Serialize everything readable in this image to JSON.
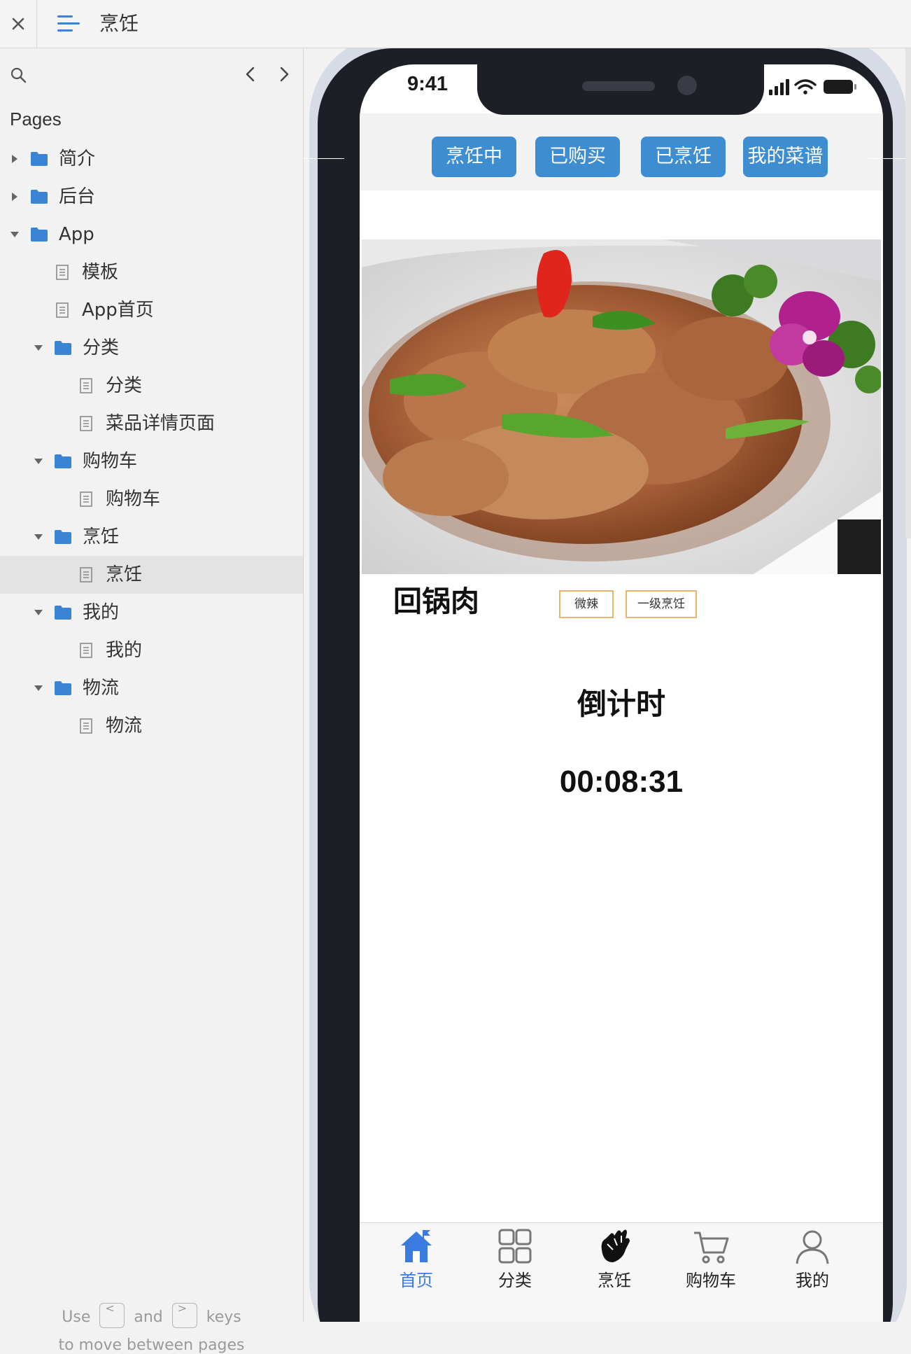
{
  "window": {
    "title": "烹饪",
    "close_icon": "close-icon",
    "menu_icon": "menu-icon"
  },
  "sidebar": {
    "pages_heading": "Pages",
    "tree": [
      {
        "label": "简介",
        "type": "folder",
        "level": 0,
        "expanded": false
      },
      {
        "label": "后台",
        "type": "folder",
        "level": 0,
        "expanded": false
      },
      {
        "label": "App",
        "type": "folder",
        "level": 0,
        "expanded": true
      },
      {
        "label": "模板",
        "type": "page",
        "level": 1
      },
      {
        "label": "App首页",
        "type": "page",
        "level": 1
      },
      {
        "label": "分类",
        "type": "folder",
        "level": 1,
        "expanded": true
      },
      {
        "label": "分类",
        "type": "page",
        "level": 2
      },
      {
        "label": "菜品详情页面",
        "type": "page",
        "level": 2
      },
      {
        "label": "购物车",
        "type": "folder",
        "level": 1,
        "expanded": true
      },
      {
        "label": "购物车",
        "type": "page",
        "level": 2
      },
      {
        "label": "烹饪",
        "type": "folder",
        "level": 1,
        "expanded": true
      },
      {
        "label": "烹饪",
        "type": "page",
        "level": 2,
        "selected": true
      },
      {
        "label": "我的",
        "type": "folder",
        "level": 1,
        "expanded": true
      },
      {
        "label": "我的",
        "type": "page",
        "level": 2
      },
      {
        "label": "物流",
        "type": "folder",
        "level": 1,
        "expanded": true
      },
      {
        "label": "物流",
        "type": "page",
        "level": 2
      }
    ],
    "hint": {
      "use": "Use",
      "key_prev": "<",
      "and": "and",
      "key_next": ">",
      "keys": "keys",
      "line2": "to move between pages"
    },
    "accent_color": "#3a84d4"
  },
  "phone": {
    "status_time": "9:41",
    "top_tabs": [
      "烹饪中",
      "已购买",
      "已烹饪",
      "我的菜谱"
    ],
    "dish_name": "回锅肉",
    "tags": [
      "微辣",
      "一级烹饪"
    ],
    "countdown_title": "倒计时",
    "countdown_value": "00:08:31",
    "tabbar": [
      {
        "label": "首页",
        "icon": "home-icon",
        "active": true
      },
      {
        "label": "分类",
        "icon": "grid-icon",
        "active": false
      },
      {
        "label": "烹饪",
        "icon": "hand-icon",
        "active": false
      },
      {
        "label": "购物车",
        "icon": "cart-icon",
        "active": false
      },
      {
        "label": "我的",
        "icon": "user-icon",
        "active": false
      }
    ],
    "button_color": "#3d8dd0",
    "tag_border_color": "#e8b56a"
  }
}
